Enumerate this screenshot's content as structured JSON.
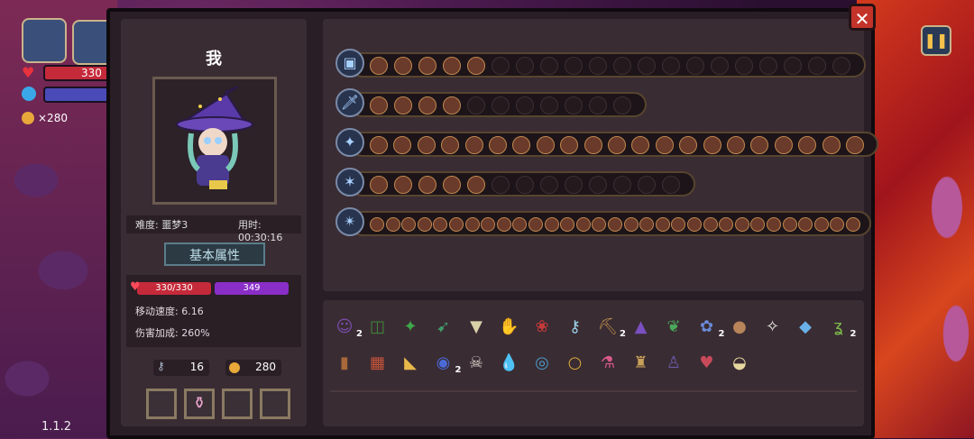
{
  "hud": {
    "hp_value": "330",
    "coin_count": "×280",
    "version": "1.1.2"
  },
  "panel": {
    "player_name": "我",
    "difficulty": "难度: 噩梦3",
    "time": "用时: 00:30:16",
    "attr_tab": "基本属性",
    "hp": "330/330",
    "mp": "349",
    "move_speed": "移动速度: 6.16",
    "damage_bonus": "伤害加成: 260%",
    "keys": "16",
    "coins": "280"
  },
  "weapons": [
    {
      "icon": "chest-icon",
      "slots_filled": 5,
      "slots_total": 20
    },
    {
      "icon": "sword-icon",
      "slots_filled": 4,
      "slots_total": 11
    },
    {
      "icon": "staff-icon",
      "slots_filled": 21,
      "slots_total": 21
    },
    {
      "icon": "wand-icon",
      "slots_filled": 5,
      "slots_total": 13
    },
    {
      "icon": "shuriken-icon",
      "slots_filled": 31,
      "slots_total": 31
    }
  ],
  "items_row1": [
    {
      "name": "wizard-portrait-item",
      "glyph": "☺",
      "color": "#7a4fb0",
      "count": "2"
    },
    {
      "name": "green-shorts-item",
      "glyph": "◫",
      "color": "#3f8a3a",
      "count": ""
    },
    {
      "name": "green-crystal-item",
      "glyph": "✦",
      "color": "#3fa84a",
      "count": ""
    },
    {
      "name": "green-bird-item",
      "glyph": "➹",
      "color": "#3f9a6a",
      "count": ""
    },
    {
      "name": "fangs-item",
      "glyph": "▼",
      "color": "#d8d0a8",
      "count": ""
    },
    {
      "name": "gauntlet-item",
      "glyph": "✋",
      "color": "#a8a8b8",
      "count": ""
    },
    {
      "name": "red-rose-item",
      "glyph": "❀",
      "color": "#c83a3a",
      "count": ""
    },
    {
      "name": "ice-key-item",
      "glyph": "⚷",
      "color": "#9ad0e8",
      "count": ""
    },
    {
      "name": "pickaxe-item",
      "glyph": "⛏",
      "color": "#b88a4a",
      "count": "2"
    },
    {
      "name": "witch-hat-item",
      "glyph": "▲",
      "color": "#7a4fc0",
      "count": ""
    },
    {
      "name": "leaf-item",
      "glyph": "❦",
      "color": "#4aa85a",
      "count": ""
    },
    {
      "name": "blue-lotus-item",
      "glyph": "✿",
      "color": "#6a8ad8",
      "count": "2"
    },
    {
      "name": "brown-egg-item",
      "glyph": "●",
      "color": "#b8845a",
      "count": ""
    },
    {
      "name": "white-wing-item",
      "glyph": "✧",
      "color": "#e8e8e0",
      "count": ""
    },
    {
      "name": "mirror-item",
      "glyph": "◆",
      "color": "#6ab0e8",
      "count": ""
    },
    {
      "name": "green-horn-item",
      "glyph": "ʓ",
      "color": "#7ab84a",
      "count": "2"
    }
  ],
  "items_row2": [
    {
      "name": "bracer-item",
      "glyph": "▮",
      "color": "#a8683a",
      "count": ""
    },
    {
      "name": "spellbook-item",
      "glyph": "▦",
      "color": "#c8553a",
      "count": ""
    },
    {
      "name": "candy-corn-item",
      "glyph": "◣",
      "color": "#e8b84a",
      "count": ""
    },
    {
      "name": "blue-orb-item",
      "glyph": "◉",
      "color": "#4a6ad8",
      "count": "2"
    },
    {
      "name": "skeleton-item",
      "glyph": "☠",
      "color": "#d8d0c8",
      "count": ""
    },
    {
      "name": "water-drop-item",
      "glyph": "💧",
      "color": "#6a9ae8",
      "count": ""
    },
    {
      "name": "blue-amulet-item",
      "glyph": "◎",
      "color": "#4a9ac8",
      "count": ""
    },
    {
      "name": "gold-ring-item",
      "glyph": "○",
      "color": "#d8a83a",
      "count": ""
    },
    {
      "name": "potion-item",
      "glyph": "⚗",
      "color": "#d85a8a",
      "count": ""
    },
    {
      "name": "lantern-item",
      "glyph": "♜",
      "color": "#c8a05a",
      "count": ""
    },
    {
      "name": "robe-item",
      "glyph": "♙",
      "color": "#6a5aa8",
      "count": ""
    },
    {
      "name": "heart-necklace-item",
      "glyph": "♥",
      "color": "#c84a5a",
      "count": ""
    },
    {
      "name": "sack-item",
      "glyph": "◒",
      "color": "#e8d8a0",
      "count": ""
    }
  ]
}
